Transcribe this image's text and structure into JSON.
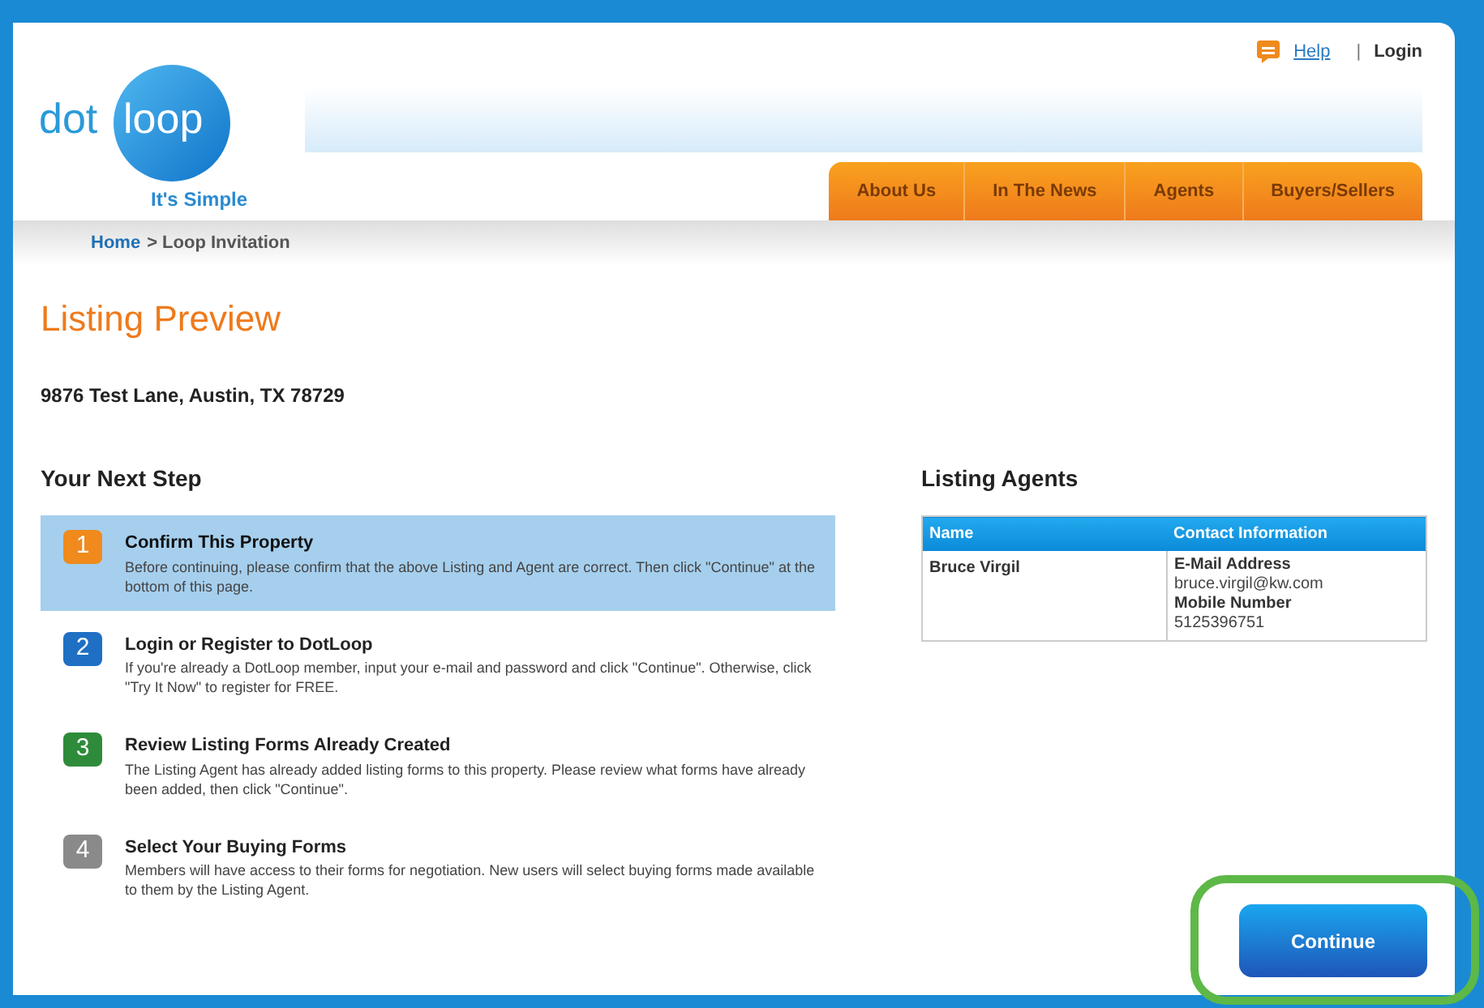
{
  "logo": {
    "word_1": "dot",
    "word_2": "loop",
    "tagline": "It's Simple"
  },
  "top_links": {
    "help": "Help",
    "separator": "|",
    "login": "Login"
  },
  "nav": [
    {
      "label": "About Us"
    },
    {
      "label": "In The News"
    },
    {
      "label": "Agents"
    },
    {
      "label": "Buyers/Sellers"
    }
  ],
  "breadcrumb": {
    "home": "Home",
    "current": "> Loop Invitation"
  },
  "title": "Listing Preview",
  "address": "9876 Test Lane, Austin, TX 78729",
  "steps_heading": "Your Next Step",
  "steps": [
    {
      "number": "1",
      "color": "#f08a1c",
      "title": "Confirm This Property",
      "text": "Before continuing, please confirm that the above Listing and Agent are correct. Then click \"Continue\" at the bottom of this page.",
      "selected": true
    },
    {
      "number": "2",
      "color": "#1f6fc4",
      "title": "Login or Register to DotLoop",
      "text": "If you're already a DotLoop member, input your e-mail and password and click \"Continue\". Otherwise, click \"Try It Now\" to register for FREE.",
      "selected": false
    },
    {
      "number": "3",
      "color": "#2e8b3a",
      "title": "Review Listing Forms Already Created",
      "text": "The Listing Agent has already added listing forms to this property. Please review what forms have already been added, then click \"Continue\".",
      "selected": false
    },
    {
      "number": "4",
      "color": "#8a8a8a",
      "title": "Select Your Buying Forms",
      "text": "Members will have access to their forms for negotiation. New users will select buying forms made available to them by the Listing Agent.",
      "selected": false
    }
  ],
  "agents_heading": "Listing Agents",
  "agents_table": {
    "columns": [
      "Name",
      "Contact Information"
    ],
    "rows": [
      {
        "name": "Bruce Virgil",
        "email_label": "E-Mail Address",
        "email": "bruce.virgil@kw.com",
        "phone_label": "Mobile Number",
        "phone": "5125396751"
      }
    ]
  },
  "continue_button": "Continue",
  "highlight": {
    "shown": true
  }
}
